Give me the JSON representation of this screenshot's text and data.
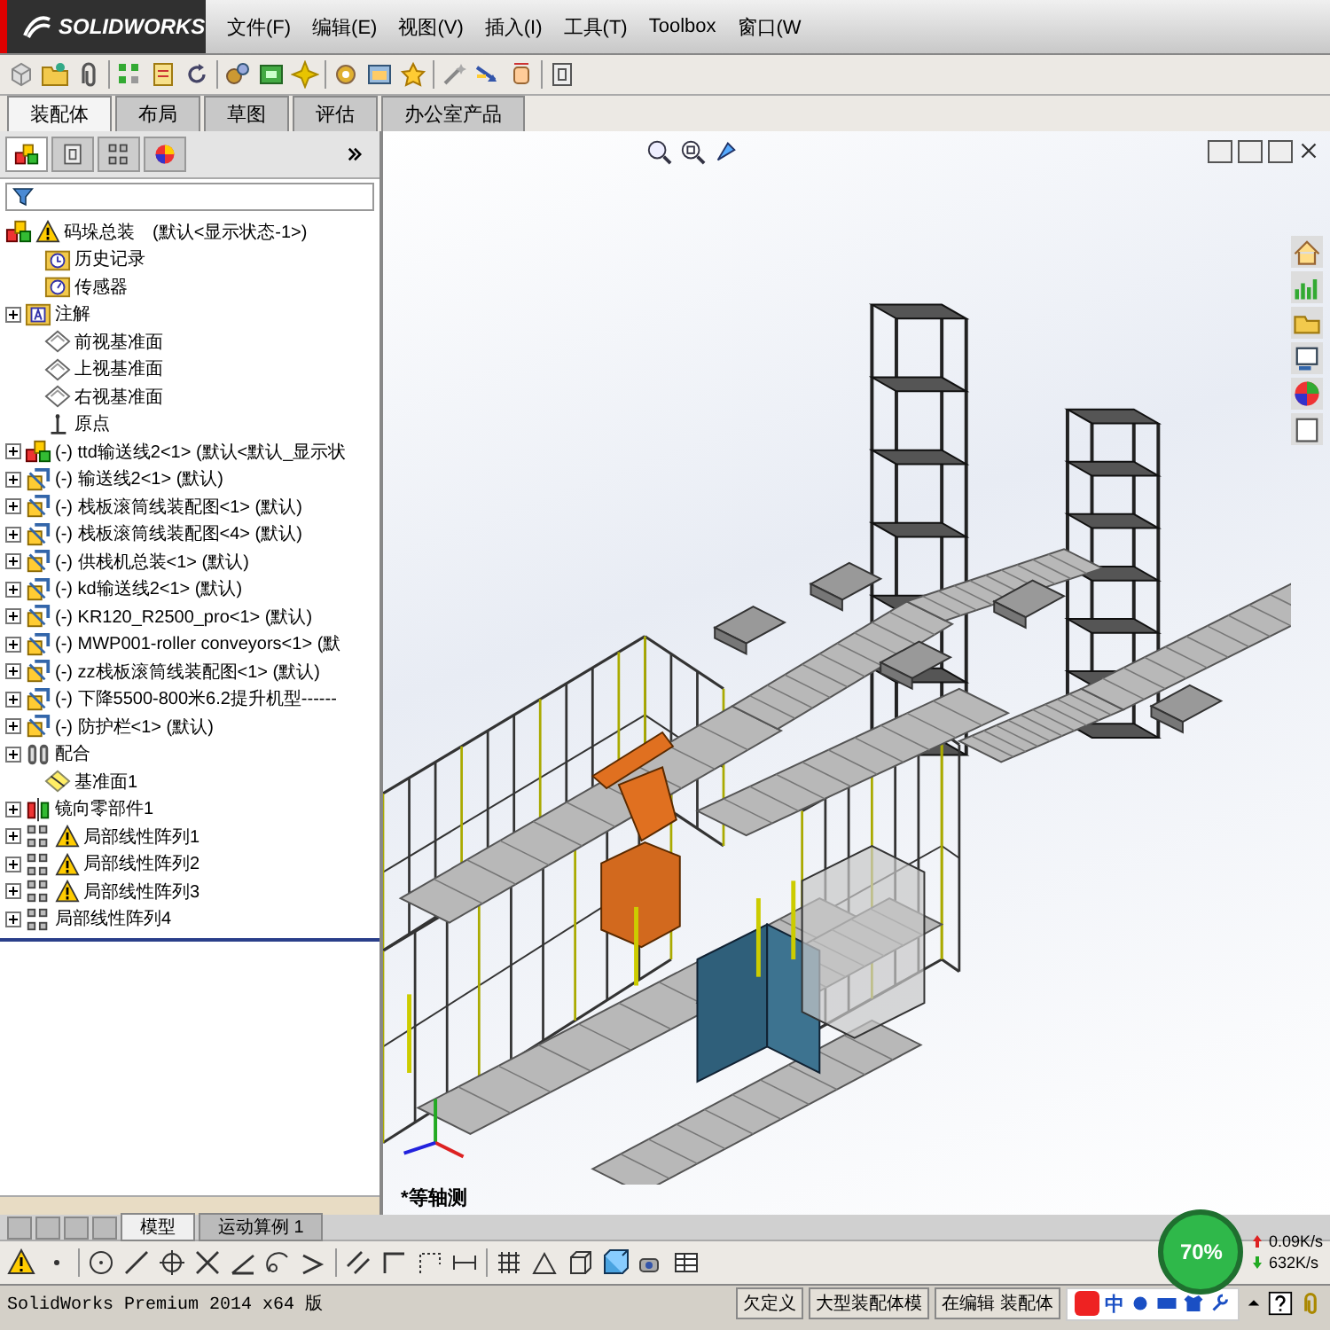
{
  "app": {
    "logo": "SOLIDWORKS"
  },
  "menu": [
    "文件(F)",
    "编辑(E)",
    "视图(V)",
    "插入(I)",
    "工具(T)",
    "Toolbox",
    "窗口(W"
  ],
  "command_tabs": [
    {
      "label": "装配体",
      "selected": true
    },
    {
      "label": "布局",
      "selected": false
    },
    {
      "label": "草图",
      "selected": false
    },
    {
      "label": "评估",
      "selected": false
    },
    {
      "label": "办公室产品",
      "selected": false
    }
  ],
  "tree": {
    "root": {
      "kind": "assembly",
      "label": "码垛总装",
      "config": "(默认<显示状态-1>)",
      "warning": true
    },
    "items": [
      {
        "kind": "history",
        "label": "历史记录",
        "expandable": false,
        "warning": false
      },
      {
        "kind": "sensor",
        "label": "传感器",
        "expandable": false,
        "warning": false
      },
      {
        "kind": "annotation",
        "label": "注解",
        "expandable": true,
        "warning": false
      },
      {
        "kind": "plane",
        "label": "前视基准面",
        "expandable": false,
        "warning": false
      },
      {
        "kind": "plane",
        "label": "上视基准面",
        "expandable": false,
        "warning": false
      },
      {
        "kind": "plane",
        "label": "右视基准面",
        "expandable": false,
        "warning": false
      },
      {
        "kind": "origin",
        "label": "原点",
        "expandable": false,
        "warning": false
      },
      {
        "kind": "assembly",
        "label": "(-) ttd输送线2<1> (默认<默认_显示状",
        "expandable": true,
        "warning": false
      },
      {
        "kind": "subassembly",
        "label": "(-) 输送线2<1> (默认)",
        "expandable": true,
        "warning": false
      },
      {
        "kind": "subassembly",
        "label": "(-) 栈板滚筒线装配图<1> (默认)",
        "expandable": true,
        "warning": false
      },
      {
        "kind": "subassembly",
        "label": "(-) 栈板滚筒线装配图<4> (默认)",
        "expandable": true,
        "warning": false
      },
      {
        "kind": "subassembly",
        "label": "(-) 供栈机总装<1> (默认)",
        "expandable": true,
        "warning": false
      },
      {
        "kind": "subassembly",
        "label": "(-) kd输送线2<1> (默认)",
        "expandable": true,
        "warning": false
      },
      {
        "kind": "subassembly",
        "label": "(-) KR120_R2500_pro<1> (默认)",
        "expandable": true,
        "warning": false
      },
      {
        "kind": "subassembly",
        "label": "(-) MWP001-roller conveyors<1> (默",
        "expandable": true,
        "warning": false
      },
      {
        "kind": "subassembly",
        "label": "(-) zz栈板滚筒线装配图<1> (默认)",
        "expandable": true,
        "warning": false
      },
      {
        "kind": "subassembly",
        "label": "(-) 下降5500-800米6.2提升机型------",
        "expandable": true,
        "warning": false
      },
      {
        "kind": "subassembly",
        "label": "(-) 防护栏<1> (默认)",
        "expandable": true,
        "warning": false
      },
      {
        "kind": "mates",
        "label": "配合",
        "expandable": true,
        "warning": false
      },
      {
        "kind": "plane-ref",
        "label": "基准面1",
        "expandable": false,
        "warning": false
      },
      {
        "kind": "mirror",
        "label": "镜向零部件1",
        "expandable": true,
        "warning": false
      },
      {
        "kind": "pattern",
        "label": "局部线性阵列1",
        "expandable": true,
        "warning": true
      },
      {
        "kind": "pattern",
        "label": "局部线性阵列2",
        "expandable": true,
        "warning": true
      },
      {
        "kind": "pattern",
        "label": "局部线性阵列3",
        "expandable": true,
        "warning": true
      },
      {
        "kind": "pattern",
        "label": "局部线性阵列4",
        "expandable": true,
        "warning": false
      }
    ]
  },
  "viewport": {
    "view_label": "*等轴测"
  },
  "bottom_tabs": [
    {
      "label": "模型",
      "selected": true
    },
    {
      "label": "运动算例 1",
      "selected": false
    }
  ],
  "status_bar": {
    "product": "SolidWorks Premium 2014 x64 版",
    "fields": [
      "欠定义",
      "大型装配体模",
      "在编辑 装配体"
    ]
  },
  "ime_bar": {
    "label": "中"
  },
  "net_meter": {
    "percent": "70%",
    "upload": "0.09K/s",
    "download": "632K/s"
  }
}
